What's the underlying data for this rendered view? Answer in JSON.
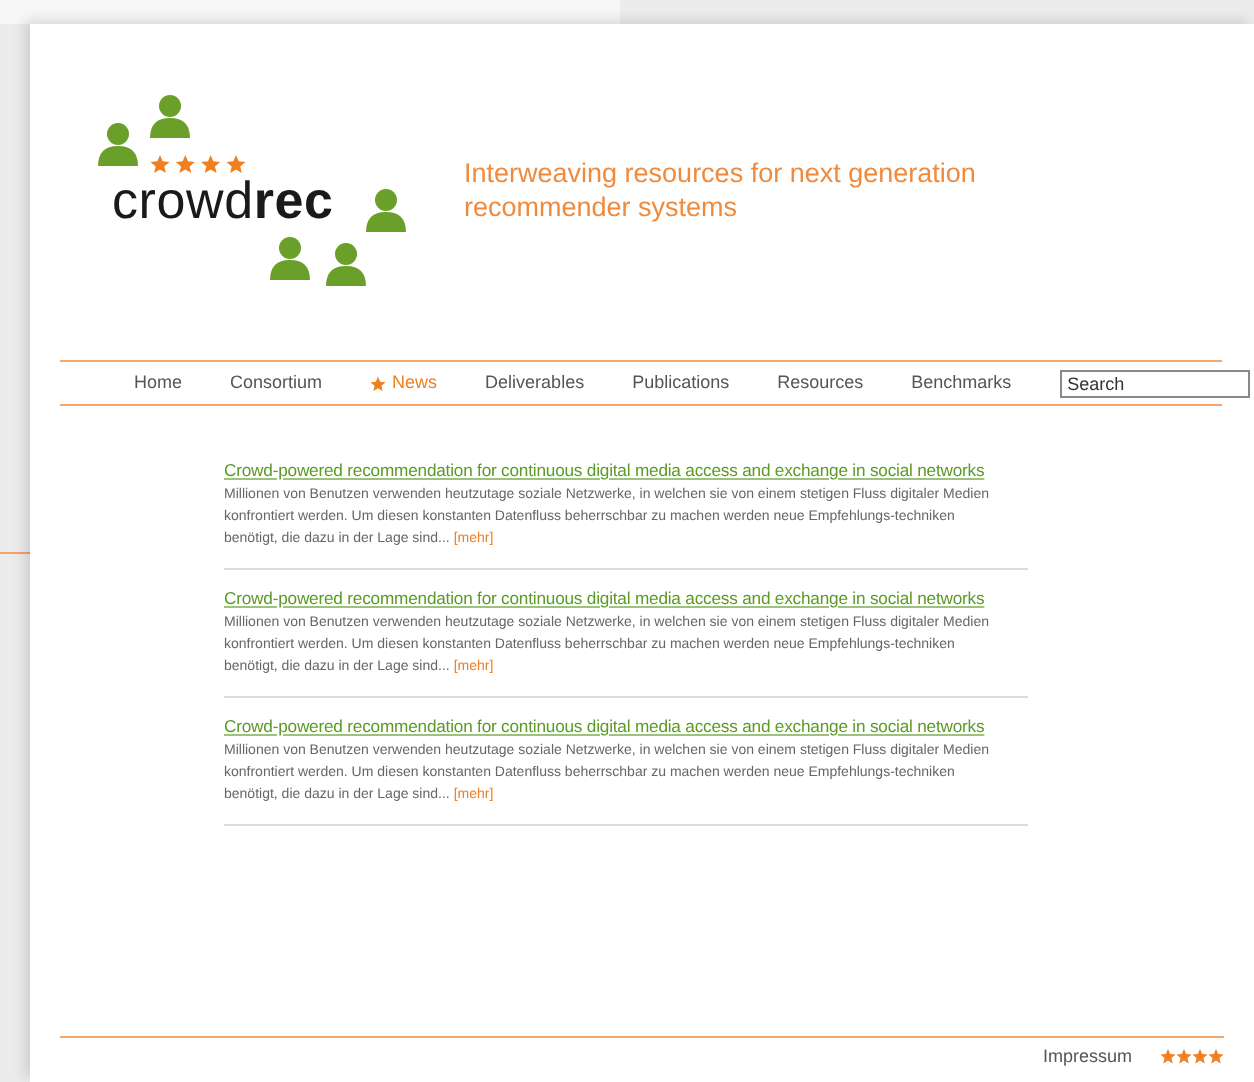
{
  "header": {
    "logo_text": "crowd**rec**",
    "tagline": "Interweaving resources for next generation recommender systems"
  },
  "nav": {
    "items": [
      {
        "label": "Home",
        "selected": false
      },
      {
        "label": "Consortium",
        "selected": false
      },
      {
        "label": "News",
        "selected": true
      },
      {
        "label": "Deliverables",
        "selected": false
      },
      {
        "label": "Publications",
        "selected": false
      },
      {
        "label": "Resources",
        "selected": false
      },
      {
        "label": "Benchmarks",
        "selected": false
      }
    ],
    "search": {
      "value": "Search"
    }
  },
  "articles": [
    {
      "title": "Crowd-powered recommendation for continuous digital media access and exchange in social networks",
      "body": "Millionen von Benutzen verwenden heutzutage soziale Netzwerke, in welchen sie von einem stetigen Fluss digitaler Medien konfrontiert werden. Um diesen konstanten Datenfluss beherrschbar zu machen werden neue Empfehlungs-techniken benötigt, die dazu in der Lage sind...",
      "more": "[mehr]"
    },
    {
      "title": "Crowd-powered recommendation for continuous digital media access and exchange in social networks",
      "body": "Millionen von Benutzen verwenden heutzutage soziale Netzwerke, in welchen sie von einem stetigen Fluss digitaler Medien konfrontiert werden. Um diesen konstanten Datenfluss beherrschbar zu machen werden neue Empfehlungs-techniken benötigt, die dazu in der Lage sind...",
      "more": "[mehr]"
    },
    {
      "title": "Crowd-powered recommendation for continuous digital media access and exchange in social networks",
      "body": "Millionen von Benutzen verwenden heutzutage soziale Netzwerke, in welchen sie von einem stetigen Fluss digitaler Medien konfrontiert werden. Um diesen konstanten Datenfluss beherrschbar zu machen werden neue Empfehlungs-techniken benötigt, die dazu in der Lage sind...",
      "more": "[mehr]"
    }
  ],
  "footer": {
    "link": "Impressum"
  }
}
